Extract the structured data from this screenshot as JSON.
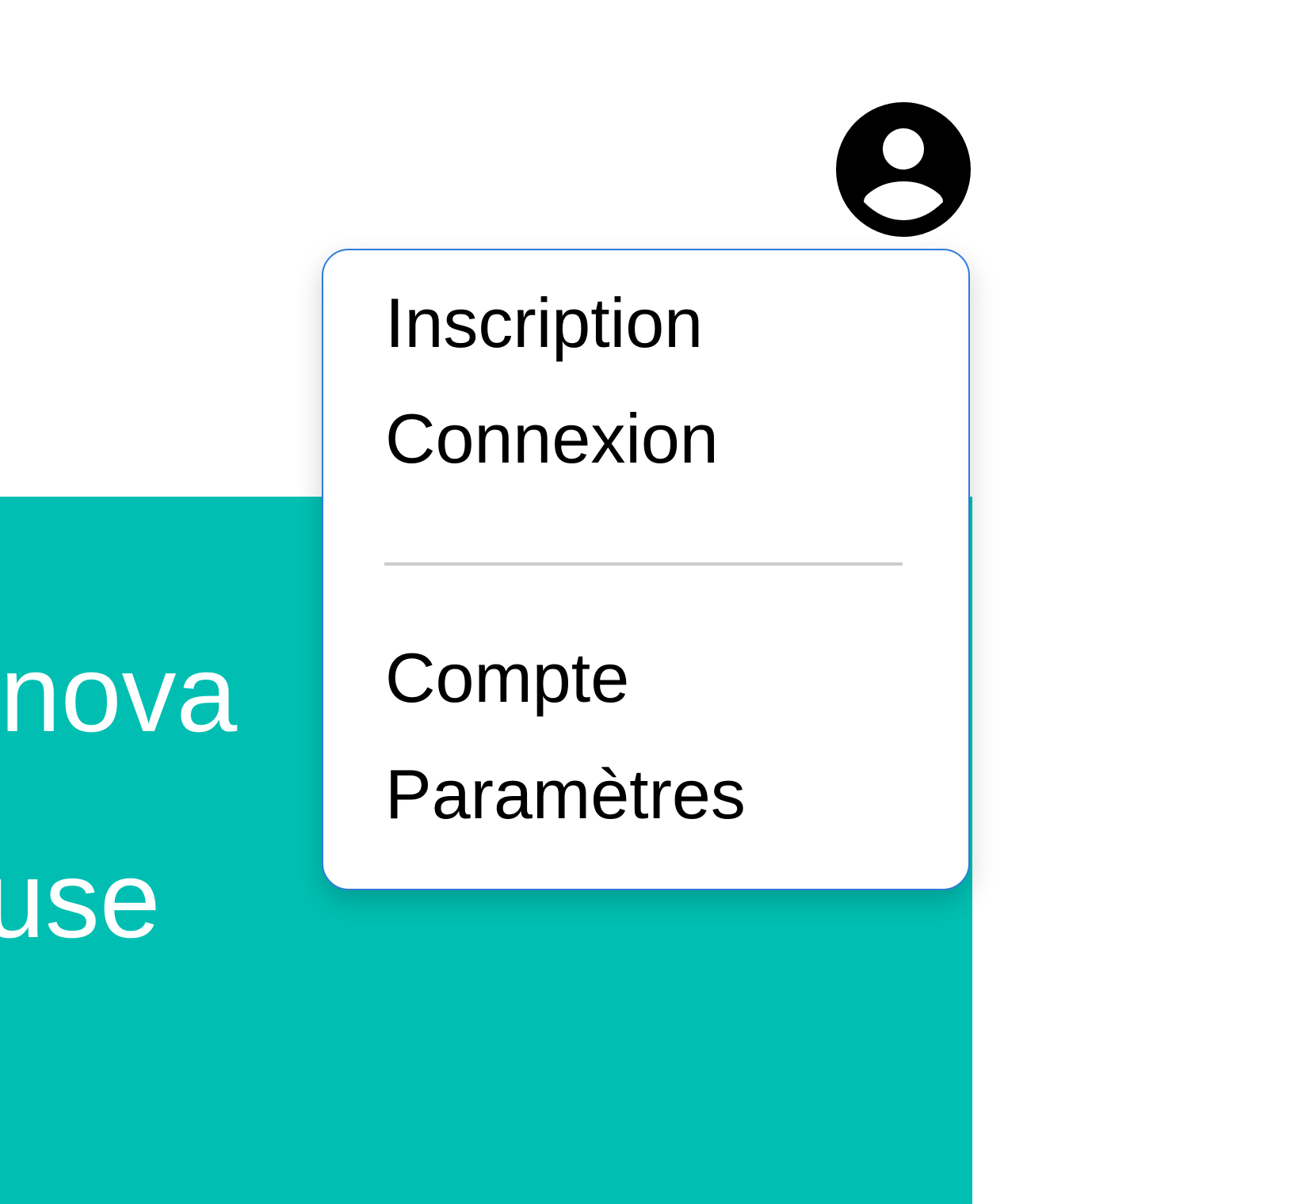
{
  "hero": {
    "line1": "nova",
    "line2": "use"
  },
  "user_menu": {
    "avatar_icon": "account-circle-icon",
    "items": [
      {
        "label": "Inscription"
      },
      {
        "label": "Connexion"
      },
      {
        "label": "Compte"
      },
      {
        "label": "Paramètres"
      }
    ]
  },
  "colors": {
    "hero_background": "#00bfb2",
    "dropdown_border": "#2f7bdc",
    "divider": "#cccccc"
  }
}
